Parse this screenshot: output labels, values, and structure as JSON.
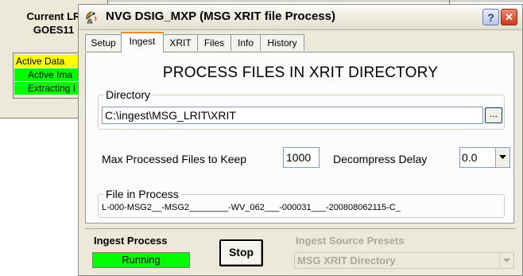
{
  "background_window": {
    "title_line1": "Current LR",
    "title_line2": "GOES11",
    "status_lines": [
      {
        "text": "Active Data",
        "color": "#ffff00"
      },
      {
        "text": "Active Ima",
        "color": "#00ff00"
      },
      {
        "text": "Extracting I",
        "color": "#00ff00"
      }
    ]
  },
  "window": {
    "title": "NVG DSIG_MXP   (MSG XRIT file Process)",
    "help_glyph": "?",
    "close_glyph": "✕",
    "icon": "satellite-dish-icon"
  },
  "tabs": [
    {
      "label": "Setup",
      "active": false
    },
    {
      "label": "Ingest",
      "active": true
    },
    {
      "label": "XRIT",
      "active": false
    },
    {
      "label": "Files",
      "active": false
    },
    {
      "label": "Info",
      "active": false
    },
    {
      "label": "History",
      "active": false
    }
  ],
  "panel": {
    "heading": "PROCESS FILES IN XRIT DIRECTORY",
    "directory": {
      "label": "Directory",
      "value": "C:\\ingest\\MSG_LRIT\\XRIT",
      "browse_label": "..."
    },
    "max_files": {
      "label": "Max Processed Files to Keep",
      "value": "1000"
    },
    "decompress": {
      "label": "Decompress Delay",
      "value": "0.0"
    },
    "file_in_process": {
      "label": "File in Process",
      "value": "L-000-MSG2__-MSG2________-WV_062___-000031___-200808062115-C_"
    }
  },
  "ingest_process": {
    "label": "Ingest Process",
    "status": "Running",
    "status_color": "#00ff00",
    "stop_label": "Stop"
  },
  "presets": {
    "label": "Ingest Source Presets",
    "value": "MSG XRIT Directory"
  }
}
